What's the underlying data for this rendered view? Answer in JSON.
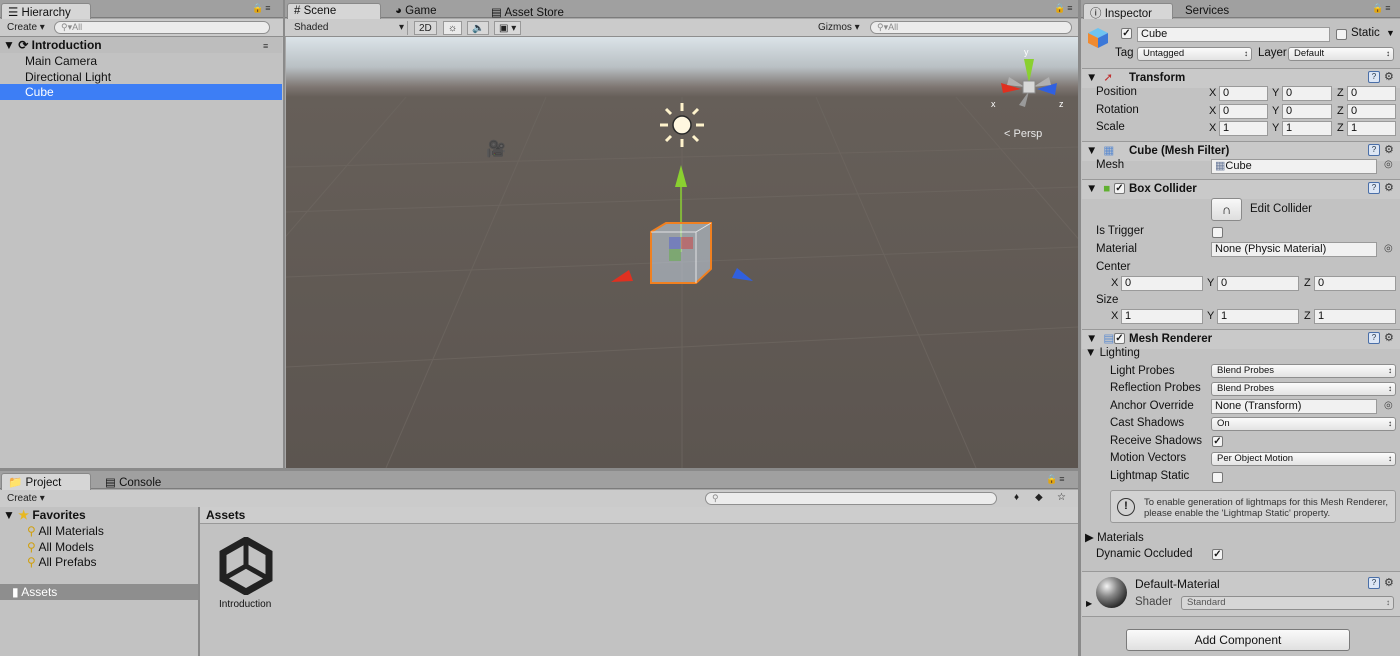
{
  "hierarchy": {
    "tab": "Hierarchy",
    "create": "Create",
    "search_placeholder": "All",
    "scene": "Introduction",
    "items": [
      "Main Camera",
      "Directional Light",
      "Cube"
    ],
    "selected": "Cube"
  },
  "scene_view": {
    "tabs": [
      "Scene",
      "Game",
      "Asset Store"
    ],
    "shading": "Shaded",
    "mode_2d": "2D",
    "gizmos": "Gizmos",
    "search_placeholder": "All",
    "gizmo_axes": {
      "x": "x",
      "y": "y",
      "z": "z"
    },
    "projection": "Persp"
  },
  "project": {
    "tabs": [
      "Project",
      "Console"
    ],
    "create": "Create",
    "favorites_label": "Favorites",
    "favorites": [
      "All Materials",
      "All Models",
      "All Prefabs"
    ],
    "assets_folder": "Assets",
    "breadcrumb": "Assets",
    "asset_items": [
      "Introduction"
    ]
  },
  "inspector": {
    "tabs": [
      "Inspector",
      "Services"
    ],
    "object_name": "Cube",
    "static_label": "Static",
    "tag_label": "Tag",
    "tag_value": "Untagged",
    "layer_label": "Layer",
    "layer_value": "Default",
    "transform": {
      "title": "Transform",
      "rows": [
        {
          "label": "Position",
          "x": "0",
          "y": "0",
          "z": "0"
        },
        {
          "label": "Rotation",
          "x": "0",
          "y": "0",
          "z": "0"
        },
        {
          "label": "Scale",
          "x": "1",
          "y": "1",
          "z": "1"
        }
      ]
    },
    "mesh_filter": {
      "title": "Cube (Mesh Filter)",
      "mesh_label": "Mesh",
      "mesh_value": "Cube"
    },
    "box_collider": {
      "title": "Box Collider",
      "edit_collider": "Edit Collider",
      "is_trigger_label": "Is Trigger",
      "material_label": "Material",
      "material_value": "None (Physic Material)",
      "center_label": "Center",
      "center": {
        "x": "0",
        "y": "0",
        "z": "0"
      },
      "size_label": "Size",
      "size": {
        "x": "1",
        "y": "1",
        "z": "1"
      }
    },
    "mesh_renderer": {
      "title": "Mesh Renderer",
      "lighting_label": "Lighting",
      "light_probes_label": "Light Probes",
      "light_probes_value": "Blend Probes",
      "reflection_probes_label": "Reflection Probes",
      "reflection_probes_value": "Blend Probes",
      "anchor_override_label": "Anchor Override",
      "anchor_override_value": "None (Transform)",
      "cast_shadows_label": "Cast Shadows",
      "cast_shadows_value": "On",
      "receive_shadows_label": "Receive Shadows",
      "receive_shadows": true,
      "motion_vectors_label": "Motion Vectors",
      "motion_vectors_value": "Per Object Motion",
      "lightmap_static_label": "Lightmap Static",
      "lightmap_static": false,
      "info_text": "To enable generation of lightmaps for this Mesh Renderer, please enable the 'Lightmap Static' property.",
      "materials_label": "Materials",
      "dynamic_occluded_label": "Dynamic Occluded",
      "dynamic_occluded": true
    },
    "material": {
      "name": "Default-Material",
      "shader_label": "Shader",
      "shader_value": "Standard"
    },
    "add_component": "Add Component"
  },
  "colors": {
    "selection": "#3d7ef5",
    "scene_ground": "#5f5852",
    "sky": "#c8d2d9",
    "x_axis": "#e03020",
    "y_axis": "#8ad030",
    "z_axis": "#3060e0",
    "selection_outline": "#f08020"
  }
}
